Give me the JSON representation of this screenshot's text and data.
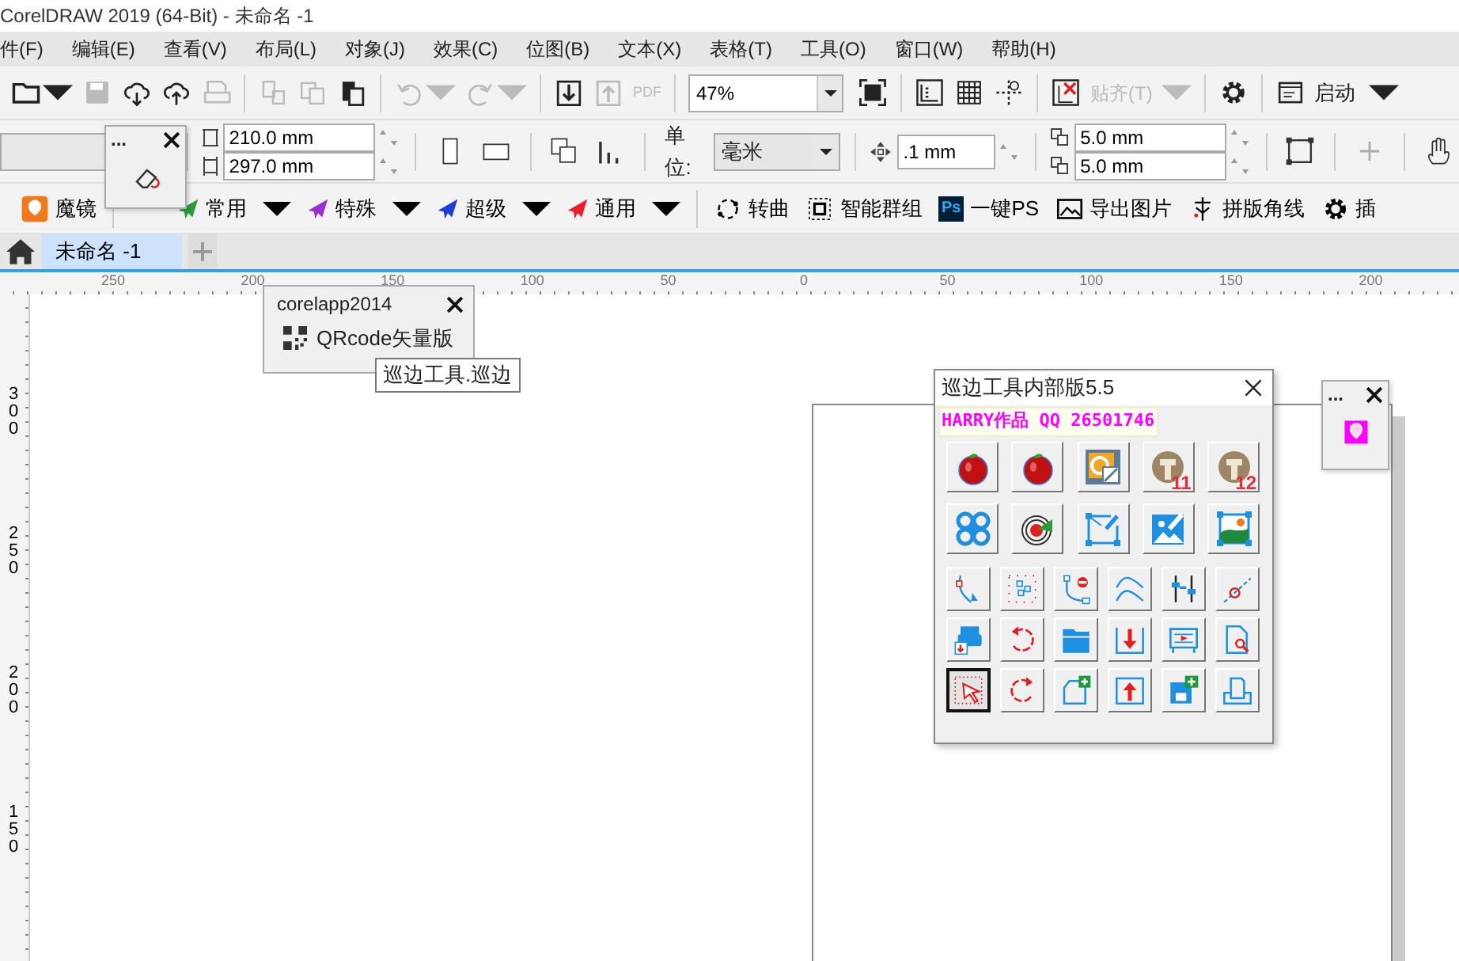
{
  "window": {
    "title": "CorelDRAW 2019 (64-Bit) - 未命名 -1"
  },
  "menu": [
    "件(F)",
    "编辑(E)",
    "查看(V)",
    "布局(L)",
    "对象(J)",
    "效果(C)",
    "位图(B)",
    "文本(X)",
    "表格(T)",
    "工具(O)",
    "窗口(W)",
    "帮助(H)"
  ],
  "toolbar": [
    {
      "kind": "folder",
      "disabled": false,
      "caret": true
    },
    {
      "kind": "save",
      "disabled": true
    },
    {
      "kind": "cloud-down",
      "disabled": false
    },
    {
      "kind": "cloud-up",
      "disabled": false
    },
    {
      "kind": "print",
      "disabled": true
    },
    {
      "kind": "sep"
    },
    {
      "kind": "copy-props",
      "disabled": true
    },
    {
      "kind": "copy",
      "disabled": true
    },
    {
      "kind": "paste",
      "disabled": false
    },
    {
      "kind": "sep"
    },
    {
      "kind": "undo",
      "disabled": true,
      "caret": true
    },
    {
      "kind": "redo",
      "disabled": true,
      "caret": true
    },
    {
      "kind": "sep"
    },
    {
      "kind": "import",
      "disabled": false
    },
    {
      "kind": "export",
      "disabled": true
    },
    {
      "kind": "pdf",
      "disabled": true,
      "label": "PDF"
    },
    {
      "kind": "sep"
    },
    {
      "kind": "zoom",
      "value": "47%"
    },
    {
      "kind": "fullscreen",
      "disabled": false
    },
    {
      "kind": "sep"
    },
    {
      "kind": "ruler",
      "disabled": false
    },
    {
      "kind": "grid",
      "disabled": false
    },
    {
      "kind": "guides",
      "disabled": false
    },
    {
      "kind": "sep"
    },
    {
      "kind": "snap-off",
      "disabled": false
    },
    {
      "kind": "dropdown",
      "label": "贴齐(T)",
      "disabled": true
    },
    {
      "kind": "sep"
    },
    {
      "kind": "gear",
      "disabled": false
    },
    {
      "kind": "sep"
    },
    {
      "kind": "launch",
      "label": "启动",
      "disabled": false
    }
  ],
  "property_bar": {
    "width": "210.0 mm",
    "height": "297.0 mm",
    "unit_label": "单位:",
    "unit": "毫米",
    "nudge": ".1 mm",
    "dup_x": "5.0 mm",
    "dup_y": "5.0 mm"
  },
  "custom_toolbar": [
    {
      "kind": "balloon",
      "label": "魔镜"
    },
    {
      "kind": "sep"
    },
    {
      "kind": "plane",
      "label": "常用",
      "color": "#2a9d3a",
      "caret": true
    },
    {
      "kind": "plane",
      "label": "特殊",
      "color": "#9b2fd4",
      "caret": true
    },
    {
      "kind": "plane",
      "label": "超级",
      "color": "#1b3fd8",
      "caret": true
    },
    {
      "kind": "plane",
      "label": "通用",
      "color": "#e8202a",
      "caret": true
    },
    {
      "kind": "sep"
    },
    {
      "kind": "curve",
      "label": "转曲"
    },
    {
      "kind": "group",
      "label": "智能群组"
    },
    {
      "kind": "ps",
      "icon_text": "Ps",
      "label": "一键PS"
    },
    {
      "kind": "picture",
      "label": "导出图片"
    },
    {
      "kind": "crop-marks",
      "label": "拼版角线"
    },
    {
      "kind": "gear",
      "label": "插"
    }
  ],
  "tabs": [
    {
      "label": "未命名 -1",
      "selected": true
    }
  ],
  "rulers": {
    "horizontal": [
      "250",
      "200",
      "150",
      "100",
      "50",
      "0",
      "50",
      "100",
      "150",
      "200"
    ],
    "vertical": [
      "300",
      "250",
      "200",
      "150"
    ]
  },
  "dockers": [
    {
      "menu": "...",
      "kind": "eraser"
    },
    {
      "menu": "...",
      "kind": "balloon-pink"
    }
  ],
  "popup": {
    "title": "corelapp2014",
    "item": "QRcode矢量版",
    "tooltip": "巡边工具.巡边"
  },
  "tool_window": {
    "title": "巡边工具内部版5.5",
    "banner": "HARRY作品 QQ 26501746",
    "rows": [
      [
        {
          "kind": "apple",
          "selected": false
        },
        {
          "kind": "apple",
          "selected": false
        },
        {
          "kind": "rings-square",
          "selected": false
        },
        {
          "kind": "medal",
          "text": "11",
          "selected": false
        },
        {
          "kind": "medal",
          "text": "12",
          "selected": false
        }
      ],
      [
        {
          "kind": "clover",
          "selected": false
        },
        {
          "kind": "target",
          "selected": false
        },
        {
          "kind": "frame-pen",
          "selected": false
        },
        {
          "kind": "image-pen",
          "selected": false
        },
        {
          "kind": "image-frame",
          "selected": false
        }
      ],
      [
        {
          "kind": "curve-node",
          "selected": false
        },
        {
          "kind": "dots",
          "selected": false
        },
        {
          "kind": "node-minus",
          "selected": false
        },
        {
          "kind": "wave",
          "selected": false
        },
        {
          "kind": "sliders",
          "selected": false
        },
        {
          "kind": "line-node",
          "selected": false
        }
      ],
      [
        {
          "kind": "printer",
          "selected": false
        },
        {
          "kind": "undo-red",
          "selected": false
        },
        {
          "kind": "folder-blue",
          "selected": false
        },
        {
          "kind": "down-arrow",
          "selected": false
        },
        {
          "kind": "plotter",
          "selected": false
        },
        {
          "kind": "file-search",
          "selected": false
        }
      ],
      [
        {
          "kind": "cursor",
          "selected": true
        },
        {
          "kind": "redo-red",
          "selected": false
        },
        {
          "kind": "file-plus",
          "selected": false
        },
        {
          "kind": "up-arrow",
          "selected": false
        },
        {
          "kind": "disk-plus",
          "selected": false
        },
        {
          "kind": "tray",
          "selected": false
        }
      ]
    ]
  }
}
